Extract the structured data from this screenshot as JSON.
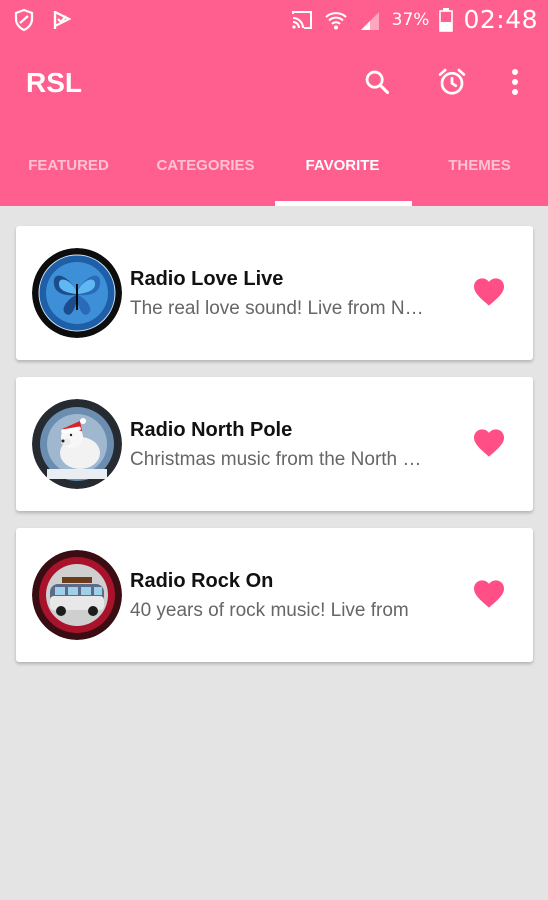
{
  "status_bar": {
    "battery_percent": "37%",
    "time": "02:48"
  },
  "app_bar": {
    "title": "RSL",
    "icons": [
      "search-icon",
      "alarm-icon",
      "more-vert-icon"
    ]
  },
  "tabs": [
    {
      "label": "FEATURED",
      "active": false
    },
    {
      "label": "CATEGORIES",
      "active": false
    },
    {
      "label": "FAVORITE",
      "active": true
    },
    {
      "label": "THEMES",
      "active": false
    }
  ],
  "stations": [
    {
      "name": "Radio Love Live",
      "description": "The real love sound! Live from New York",
      "logo": "butterfly-logo",
      "favorite": true
    },
    {
      "name": "Radio North Pole",
      "description": "Christmas music from the North Pole",
      "logo": "polar-bear-logo",
      "favorite": true
    },
    {
      "name": "Radio Rock On",
      "description": "40 years of rock music! Live from",
      "logo": "van-logo",
      "favorite": true
    }
  ],
  "colors": {
    "primary": "#ff5f8e",
    "heart": "#ff4f86",
    "background": "#e4e4e4"
  }
}
